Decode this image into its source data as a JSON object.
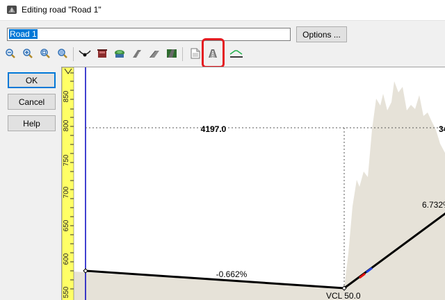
{
  "window": {
    "title": "Editing road \"Road 1\""
  },
  "road_name": {
    "value": "Road 1"
  },
  "buttons": {
    "options": "Options ...",
    "ok": "OK",
    "cancel": "Cancel",
    "help": "Help"
  },
  "toolbar": {
    "icons": [
      "zoom-out-icon",
      "zoom-in-icon",
      "zoom-window-icon",
      "zoom-extents-icon",
      "vertical-curve-icon",
      "cut-icon",
      "fill-icon",
      "road-surface-icon",
      "road-shoulder-icon",
      "road-texture-icon",
      "report-icon",
      "cross-section-icon",
      "grade-line-icon"
    ],
    "highlighted": "cross-section-icon"
  },
  "profile": {
    "axis_ticks": [
      "850",
      "800",
      "750",
      "700",
      "650",
      "600",
      "550"
    ],
    "distance_labels": [
      "4197.0",
      "34"
    ],
    "grade_labels": [
      "-0.662%",
      "6.732%"
    ],
    "vcl_label": "VCL  50.0",
    "colors": {
      "ruler": "#ffff66",
      "terrain": "#e6e2d8",
      "road": "#000000",
      "axis": "#0000c0"
    }
  }
}
